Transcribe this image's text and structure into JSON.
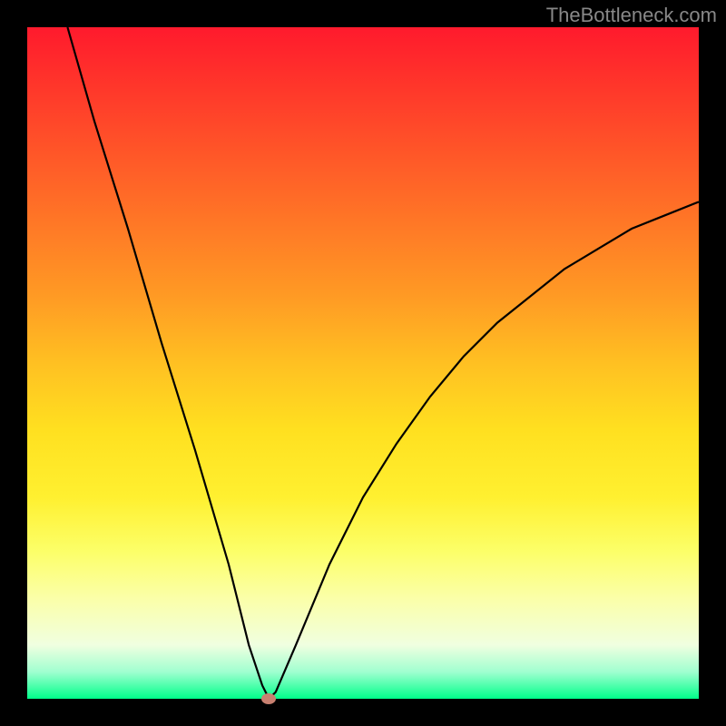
{
  "watermark": "TheBottleneck.com",
  "chart_data": {
    "type": "line",
    "title": "",
    "xlabel": "",
    "ylabel": "",
    "xlim": [
      0,
      100
    ],
    "ylim": [
      0,
      100
    ],
    "background": "rainbow-gradient-red-to-green",
    "series": [
      {
        "name": "bottleneck-curve",
        "x": [
          6,
          10,
          15,
          20,
          25,
          30,
          33,
          35,
          36,
          37,
          40,
          45,
          50,
          55,
          60,
          65,
          70,
          75,
          80,
          85,
          90,
          95,
          100
        ],
        "values": [
          100,
          86,
          70,
          53,
          37,
          20,
          8,
          2,
          0,
          1,
          8,
          20,
          30,
          38,
          45,
          51,
          56,
          60,
          64,
          67,
          70,
          72,
          74
        ]
      }
    ],
    "marker": {
      "x": 36,
      "y": 0,
      "color": "#c88070"
    }
  }
}
